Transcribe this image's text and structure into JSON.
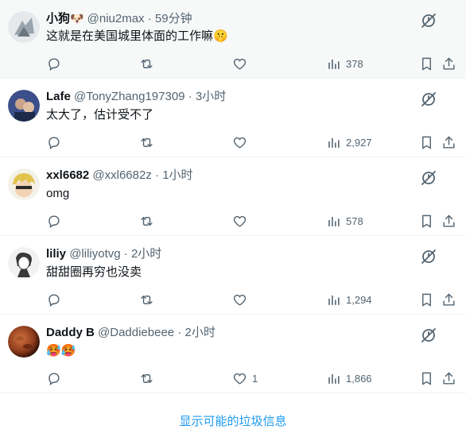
{
  "replies": [
    {
      "name": "小狗",
      "name_emoji": "🐶",
      "handle": "@niu2max",
      "separator": "·",
      "time": "59分钟",
      "text": "这就是在美国城里体面的工作嘛🤫",
      "likes": "",
      "views": "378",
      "highlighted": true,
      "avatar_color": "#9aa4ad"
    },
    {
      "name": "Lafe",
      "handle": "@TonyZhang197309",
      "separator": "·",
      "time": "3小时",
      "text": "太大了，估计受不了",
      "likes": "",
      "views": "2,927",
      "avatar_color": "#3c4f8a"
    },
    {
      "name": "xxl6682",
      "handle": "@xxl6682z",
      "separator": "·",
      "time": "1小时",
      "text": "omg",
      "likes": "",
      "views": "578",
      "avatar_color": "#e2c34e"
    },
    {
      "name": "liliy",
      "handle": "@liliyotvg",
      "separator": "·",
      "time": "2小时",
      "text": "甜甜圈再穷也没卖",
      "likes": "",
      "views": "1,294",
      "avatar_color": "#d9d9d9"
    },
    {
      "name": "Daddy B",
      "handle": "@Daddiebeee",
      "separator": "·",
      "time": "2小时",
      "text": "🥵🥵",
      "likes": "1",
      "views": "1,866",
      "avatar_color": "#a0522d"
    }
  ],
  "show_more_label": "显示可能的垃圾信息",
  "icons": {
    "mute": "mute-icon",
    "reply": "reply-icon",
    "retweet": "retweet-icon",
    "like": "like-icon",
    "views": "views-icon",
    "bookmark": "bookmark-icon",
    "share": "share-icon"
  },
  "colors": {
    "text_primary": "#0f1419",
    "text_secondary": "#536471",
    "link": "#1d9bf0",
    "highlight_bg": "#f7f9f9",
    "divider": "#eff3f4"
  }
}
